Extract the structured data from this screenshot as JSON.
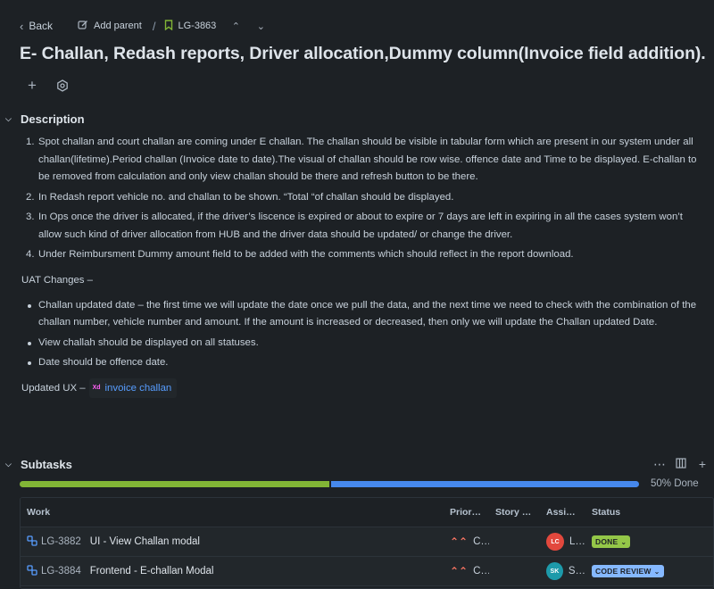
{
  "topbar": {
    "back_label": "Back",
    "add_parent_label": "Add parent",
    "separator": "/",
    "issue_key": "LG-3863"
  },
  "issue": {
    "title": "E- Challan, Redash reports, Driver allocation,Dummy column(Invoice field addition)."
  },
  "description": {
    "heading": "Description",
    "numbered": [
      {
        "num": "1.",
        "text": "Spot challan and court challan are coming under E challan. The challan should be visible in tabular form which are present in our system under all challan(lifetime).Period challan (Invoice date to date).The visual of challan should be row wise. offence date and Time  to be displayed. E-challan to be removed from calculation and only view challan should be there and refresh button to be there."
      },
      {
        "num": "2.",
        "text": "In Redash report vehicle no. and challan to be shown. “Total “of challan should be displayed."
      },
      {
        "num": "3.",
        "text": "In Ops once the driver is allocated, if the driver’s liscence is expired or about to expire or 7 days are left in expiring in all the cases system won’t allow such kind of driver allocation from HUB and the driver data should be updated/ or change the driver."
      },
      {
        "num": "4.",
        "text": "Under Reimbursment Dummy amount field to be added with the comments which should reflect in the report download."
      }
    ],
    "uat_heading": "UAT Changes –",
    "bullets": [
      "Challan updated date – the first time we will update the date once we pull the data, and the next time we need to check with the combination of the challan number, vehicle number and amount. If the amount is increased or decreased, then only we will update the Challan updated Date.",
      "View challah should be displayed on all statuses.",
      " Date should be offence date."
    ],
    "ux_label": "Updated UX –",
    "ux_link_badge": "Xd",
    "ux_link_text": "invoice challan"
  },
  "subtasks": {
    "heading": "Subtasks",
    "progress": 0.5,
    "progress_label": "50% Done",
    "colors": {
      "done": "#82b536",
      "remaining": "#4688ec"
    },
    "columns": [
      "Work",
      "Prior…",
      "Story …",
      "Assi…",
      "Status"
    ],
    "rows": [
      {
        "key": "LG-3882",
        "summary": "UI - View Challan modal",
        "priority": "C…",
        "story_points": "",
        "assignee_initials": "LC",
        "assignee_color": "#e2483d",
        "assignee_name": "L…",
        "status": "DONE",
        "status_color": "#94c748"
      },
      {
        "key": "LG-3884",
        "summary": "Frontend - E-challan Modal",
        "priority": "C…",
        "story_points": "",
        "assignee_initials": "SK",
        "assignee_color": "#1d9aaa",
        "assignee_name": "S…",
        "status": "CODE REVIEW",
        "status_color": "#85b8ff"
      }
    ]
  }
}
